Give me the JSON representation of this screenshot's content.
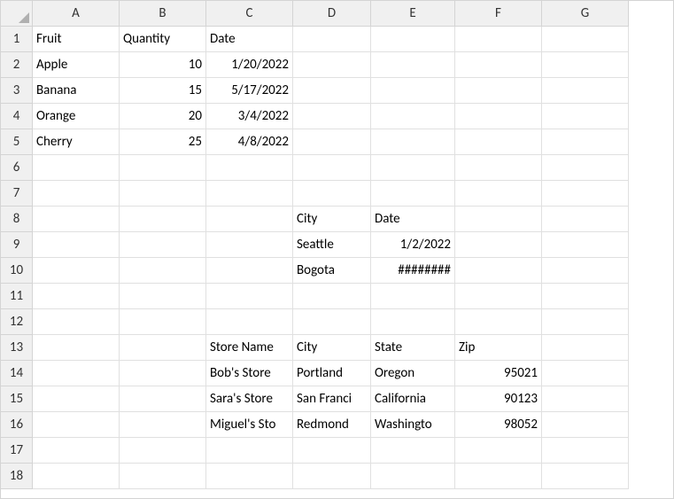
{
  "chart_data": {
    "type": "table",
    "tables": [
      {
        "range": "A1:C5",
        "header": [
          "Fruit",
          "Quantity",
          "Date"
        ],
        "rows": [
          [
            "Apple",
            10,
            "1/20/2022"
          ],
          [
            "Banana",
            15,
            "5/17/2022"
          ],
          [
            "Orange",
            20,
            "3/4/2022"
          ],
          [
            "Cherry",
            25,
            "4/8/2022"
          ]
        ]
      },
      {
        "range": "D8:E10",
        "header": [
          "City",
          "Date"
        ],
        "rows": [
          [
            "Seattle",
            "1/2/2022"
          ],
          [
            "Bogota",
            "########"
          ]
        ]
      },
      {
        "range": "C13:F16",
        "header": [
          "Store Name",
          "City",
          "State",
          "Zip"
        ],
        "rows": [
          [
            "Bob's Store",
            "Portland",
            "Oregon",
            95021
          ],
          [
            "Sara's Store",
            "San Francisco",
            "California",
            90123
          ],
          [
            "Miguel's Store",
            "Redmond",
            "Washington",
            98052
          ]
        ]
      }
    ]
  },
  "columns": [
    "A",
    "B",
    "C",
    "D",
    "E",
    "F",
    "G"
  ],
  "rows": [
    "1",
    "2",
    "3",
    "4",
    "5",
    "6",
    "7",
    "8",
    "9",
    "10",
    "11",
    "12",
    "13",
    "14",
    "15",
    "16",
    "17",
    "18"
  ],
  "cells": {
    "A1": "Fruit",
    "B1": "Quantity",
    "C1": "Date",
    "A2": "Apple",
    "B2": "10",
    "C2": "1/20/2022",
    "A3": "Banana",
    "B3": "15",
    "C3": "5/17/2022",
    "A4": "Orange",
    "B4": "20",
    "C4": "3/4/2022",
    "A5": "Cherry",
    "B5": "25",
    "C5": "4/8/2022",
    "D8": "City",
    "E8": "Date",
    "D9": "Seattle",
    "E9": "1/2/2022",
    "D10": "Bogota",
    "E10": "########",
    "C13": "Store Name",
    "D13": "City",
    "E13": "State",
    "F13": "Zip",
    "C14": "Bob's Store",
    "D14": "Portland",
    "E14": "Oregon",
    "F14": "95021",
    "C15": "Sara's Store",
    "D15": "San Franci",
    "E15": "California",
    "F15": "90123",
    "C16": "Miguel's Sto",
    "D16": "Redmond",
    "E16": "Washingto",
    "F16": "98052"
  },
  "align": {
    "B2": "num",
    "B3": "num",
    "B4": "num",
    "B5": "num",
    "C2": "num",
    "C3": "num",
    "C4": "num",
    "C5": "num",
    "E9": "num",
    "E10": "num",
    "F14": "num",
    "F15": "num",
    "F16": "num"
  }
}
